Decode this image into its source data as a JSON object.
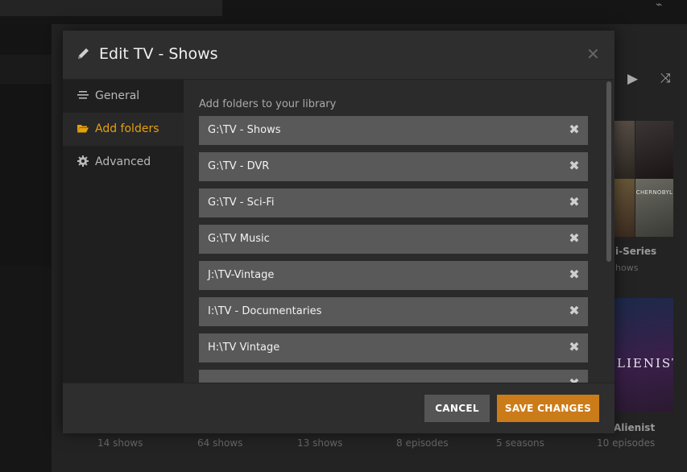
{
  "modal": {
    "title": "Edit TV - Shows",
    "sidebar": [
      {
        "label": "General",
        "icon": "list-icon",
        "active": false
      },
      {
        "label": "Add folders",
        "icon": "folder-open-icon",
        "active": true
      },
      {
        "label": "Advanced",
        "icon": "gear-icon",
        "active": false
      }
    ],
    "section_label": "Add folders to your library",
    "folders": [
      "G:\\TV - Shows",
      "G:\\TV - DVR",
      "G:\\TV - Sci-Fi",
      "G:\\TV Music",
      "J:\\TV-Vintage",
      "I:\\TV - Documentaries",
      "H:\\TV Vintage",
      ""
    ],
    "cancel_label": "CANCEL",
    "save_label": "SAVE CHANGES"
  },
  "background": {
    "posters": {
      "chernobyl": "CHERNOBYL",
      "alienist": "LIENIST"
    },
    "card1_title": "i-Series",
    "card1_sub": "hows",
    "card2_title": "Alienist",
    "stats": [
      "14 shows",
      "64 shows",
      "13 shows",
      "8 episodes",
      "5 seasons",
      "10 episodes"
    ]
  },
  "colors": {
    "accent": "#e5a00d",
    "save_button": "#cc7b19",
    "folder_row": "#595959"
  }
}
